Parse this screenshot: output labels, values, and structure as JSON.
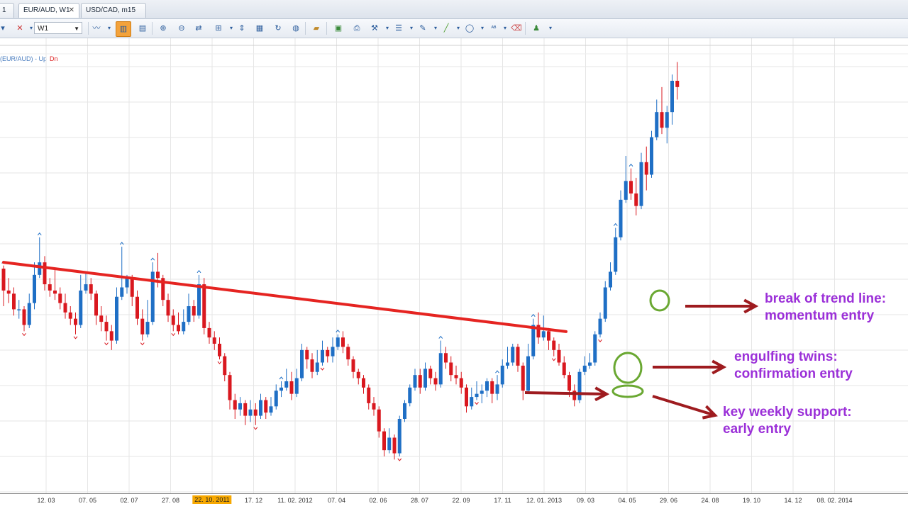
{
  "tabs": [
    {
      "label": "1",
      "left": 0,
      "width": 22
    },
    {
      "label": "EUR/AUD, W1",
      "left": 26,
      "width": 86,
      "active": true,
      "closable": true
    },
    {
      "label": "USD/CAD, m15",
      "left": 114,
      "width": 92
    }
  ],
  "toolbar": {
    "timeframe": "W1",
    "icons": [
      "cursor-icon",
      "crosshair-icon",
      "chart-type-icon",
      "bar-chart-icon",
      "candle-chart-icon",
      "zoom-in-icon",
      "zoom-out-icon",
      "autoscroll-icon",
      "vertical-line-icon",
      "template-icon",
      "refresh-icon",
      "globe-icon",
      "ruler-icon",
      "image-icon",
      "print-icon",
      "tool-icon",
      "lines-icon",
      "pen-icon",
      "line-icon",
      "ellipse-icon",
      "text-icon",
      "eraser-icon",
      "people-icon"
    ]
  },
  "legend": {
    "pair": "(EUR/AUD)",
    "separator": "-",
    "up": "Up",
    "dn": "Dn"
  },
  "colors": {
    "bull": "#1f6fc5",
    "bear": "#d9181f",
    "trendline": "#e52421",
    "arrow": "#9e1b1f",
    "circle": "#6aa832",
    "annotation": "#9b30d8"
  },
  "chart_data": {
    "type": "candlestick",
    "instrument": "EUR/AUD",
    "timeframe": "W1",
    "x_ticks": [
      "12. 03",
      "07. 05",
      "02. 07",
      "27. 08",
      "22. 10. 2011",
      "17. 12",
      "11. 02. 2012",
      "07. 04",
      "02. 06",
      "28. 07",
      "22. 09",
      "17. 11",
      "12. 01. 2013",
      "09. 03",
      "04. 05",
      "29. 06",
      "24. 08",
      "19. 10",
      "14. 12",
      "08. 02. 2014"
    ],
    "highlighted_tick": "22. 10. 2011",
    "candles": [
      [
        60,
        53,
        61,
        48
      ],
      [
        53,
        52,
        57,
        49
      ],
      [
        52,
        47,
        54,
        45
      ],
      [
        47,
        47,
        50,
        44
      ],
      [
        47,
        42,
        48,
        40
      ],
      [
        42,
        49,
        52,
        41
      ],
      [
        49,
        58,
        62,
        47
      ],
      [
        58,
        62,
        70,
        57
      ],
      [
        62,
        55,
        64,
        53
      ],
      [
        55,
        53,
        57,
        51
      ],
      [
        53,
        52,
        60,
        50
      ],
      [
        52,
        49,
        54,
        47
      ],
      [
        49,
        46,
        52,
        44
      ],
      [
        46,
        44,
        48,
        42
      ],
      [
        44,
        42,
        46,
        39
      ],
      [
        42,
        53,
        58,
        41
      ],
      [
        53,
        55,
        59,
        52
      ],
      [
        55,
        52,
        57,
        50
      ],
      [
        52,
        45,
        53,
        42
      ],
      [
        45,
        43,
        48,
        40
      ],
      [
        43,
        40,
        45,
        37
      ],
      [
        40,
        37,
        42,
        34
      ],
      [
        37,
        51,
        54,
        36
      ],
      [
        51,
        54,
        67,
        50
      ],
      [
        54,
        57,
        58,
        52
      ],
      [
        57,
        51,
        58,
        48
      ],
      [
        51,
        44,
        53,
        42
      ],
      [
        44,
        39,
        47,
        37
      ],
      [
        39,
        43,
        50,
        38
      ],
      [
        43,
        59,
        62,
        42
      ],
      [
        59,
        57,
        65,
        54
      ],
      [
        57,
        50,
        58,
        48
      ],
      [
        50,
        45,
        52,
        43
      ],
      [
        45,
        42,
        47,
        40
      ],
      [
        42,
        40,
        46,
        39
      ],
      [
        40,
        43,
        47,
        39
      ],
      [
        43,
        48,
        52,
        42
      ],
      [
        48,
        45,
        50,
        43
      ],
      [
        45,
        55,
        58,
        44
      ],
      [
        55,
        41,
        57,
        39
      ],
      [
        41,
        38,
        43,
        36
      ],
      [
        38,
        36,
        40,
        34
      ],
      [
        36,
        32,
        38,
        31
      ],
      [
        32,
        26,
        33,
        24
      ],
      [
        26,
        18,
        27,
        15
      ],
      [
        18,
        15,
        20,
        12
      ],
      [
        15,
        17,
        19,
        13
      ],
      [
        17,
        13,
        18,
        10
      ],
      [
        13,
        15,
        18,
        11
      ],
      [
        15,
        13,
        17,
        10
      ],
      [
        13,
        18,
        20,
        12
      ],
      [
        18,
        14,
        19,
        12
      ],
      [
        14,
        16,
        19,
        13
      ],
      [
        16,
        21,
        23,
        15
      ],
      [
        21,
        22,
        24,
        19
      ],
      [
        22,
        24,
        28,
        21
      ],
      [
        24,
        20,
        27,
        18
      ],
      [
        20,
        25,
        28,
        19
      ],
      [
        25,
        34,
        36,
        24
      ],
      [
        34,
        31,
        35,
        28
      ],
      [
        31,
        27,
        33,
        25
      ],
      [
        27,
        30,
        34,
        26
      ],
      [
        30,
        34,
        37,
        29
      ],
      [
        34,
        32,
        35,
        30
      ],
      [
        32,
        35,
        38,
        30
      ],
      [
        35,
        38,
        39,
        34
      ],
      [
        38,
        35,
        40,
        33
      ],
      [
        35,
        31,
        36,
        29
      ],
      [
        31,
        27,
        32,
        25
      ],
      [
        27,
        25,
        28,
        23
      ],
      [
        25,
        22,
        26,
        20
      ],
      [
        22,
        17,
        23,
        15
      ],
      [
        17,
        15,
        19,
        13
      ],
      [
        15,
        8,
        16,
        6
      ],
      [
        8,
        2,
        9,
        0
      ],
      [
        2,
        6,
        9,
        1
      ],
      [
        6,
        1,
        7,
        -1
      ],
      [
        1,
        12,
        13,
        0
      ],
      [
        12,
        17,
        18,
        11
      ],
      [
        17,
        22,
        23,
        16
      ],
      [
        22,
        26,
        28,
        21
      ],
      [
        26,
        22,
        28,
        20
      ],
      [
        22,
        28,
        30,
        21
      ],
      [
        28,
        25,
        29,
        23
      ],
      [
        25,
        23,
        27,
        21
      ],
      [
        23,
        33,
        37,
        22
      ],
      [
        33,
        30,
        35,
        28
      ],
      [
        30,
        26,
        32,
        24
      ],
      [
        26,
        25,
        29,
        23
      ],
      [
        25,
        22,
        27,
        20
      ],
      [
        22,
        16,
        23,
        14
      ],
      [
        16,
        19,
        22,
        15
      ],
      [
        19,
        20,
        24,
        18
      ],
      [
        20,
        21,
        23,
        17
      ],
      [
        21,
        24,
        25,
        19
      ],
      [
        24,
        20,
        25,
        17
      ],
      [
        20,
        23,
        26,
        18
      ],
      [
        23,
        29,
        31,
        22
      ],
      [
        29,
        30,
        35,
        28
      ],
      [
        30,
        35,
        36,
        29
      ],
      [
        35,
        29,
        36,
        27
      ],
      [
        29,
        21,
        30,
        18
      ],
      [
        21,
        32,
        36,
        20
      ],
      [
        32,
        42,
        44,
        31
      ],
      [
        42,
        38,
        46,
        36
      ],
      [
        38,
        40,
        45,
        37
      ],
      [
        40,
        37,
        41,
        34
      ],
      [
        37,
        34,
        38,
        32
      ],
      [
        34,
        30,
        36,
        29
      ],
      [
        30,
        26,
        32,
        25
      ],
      [
        26,
        21,
        27,
        19
      ],
      [
        21,
        18,
        23,
        16
      ],
      [
        18,
        27,
        28,
        17
      ],
      [
        27,
        29,
        32,
        26
      ],
      [
        29,
        30,
        33,
        28
      ],
      [
        30,
        39,
        40,
        29
      ],
      [
        39,
        44,
        46,
        38
      ],
      [
        44,
        54,
        56,
        43
      ],
      [
        54,
        59,
        62,
        53
      ],
      [
        59,
        70,
        73,
        58
      ],
      [
        70,
        82,
        85,
        69
      ],
      [
        82,
        88,
        96,
        81
      ],
      [
        88,
        84,
        92,
        82
      ],
      [
        84,
        80,
        89,
        77
      ],
      [
        80,
        94,
        97,
        79
      ],
      [
        94,
        90,
        99,
        85
      ],
      [
        90,
        102,
        104,
        89
      ],
      [
        102,
        110,
        114,
        101
      ],
      [
        110,
        105,
        118,
        103
      ],
      [
        105,
        110,
        112,
        100
      ],
      [
        110,
        120,
        122,
        106
      ],
      [
        120,
        118,
        126,
        114
      ]
    ],
    "trendline": {
      "from_bar": 0,
      "from_price": 62,
      "to_bar": 108,
      "to_price": 41
    },
    "fractals_up": [
      0,
      7,
      23,
      29,
      38,
      54,
      65,
      85,
      96,
      103,
      119,
      122
    ],
    "fractals_down": [
      4,
      14,
      20,
      27,
      33,
      42,
      49,
      62,
      77,
      92,
      107,
      116
    ],
    "annotations": [
      {
        "lines": [
          "break of trend line:",
          "momentum entry"
        ]
      },
      {
        "lines": [
          "engulfing twins:",
          "confirmation entry"
        ]
      },
      {
        "lines": [
          "key weekly support:",
          "early entry"
        ]
      }
    ]
  }
}
